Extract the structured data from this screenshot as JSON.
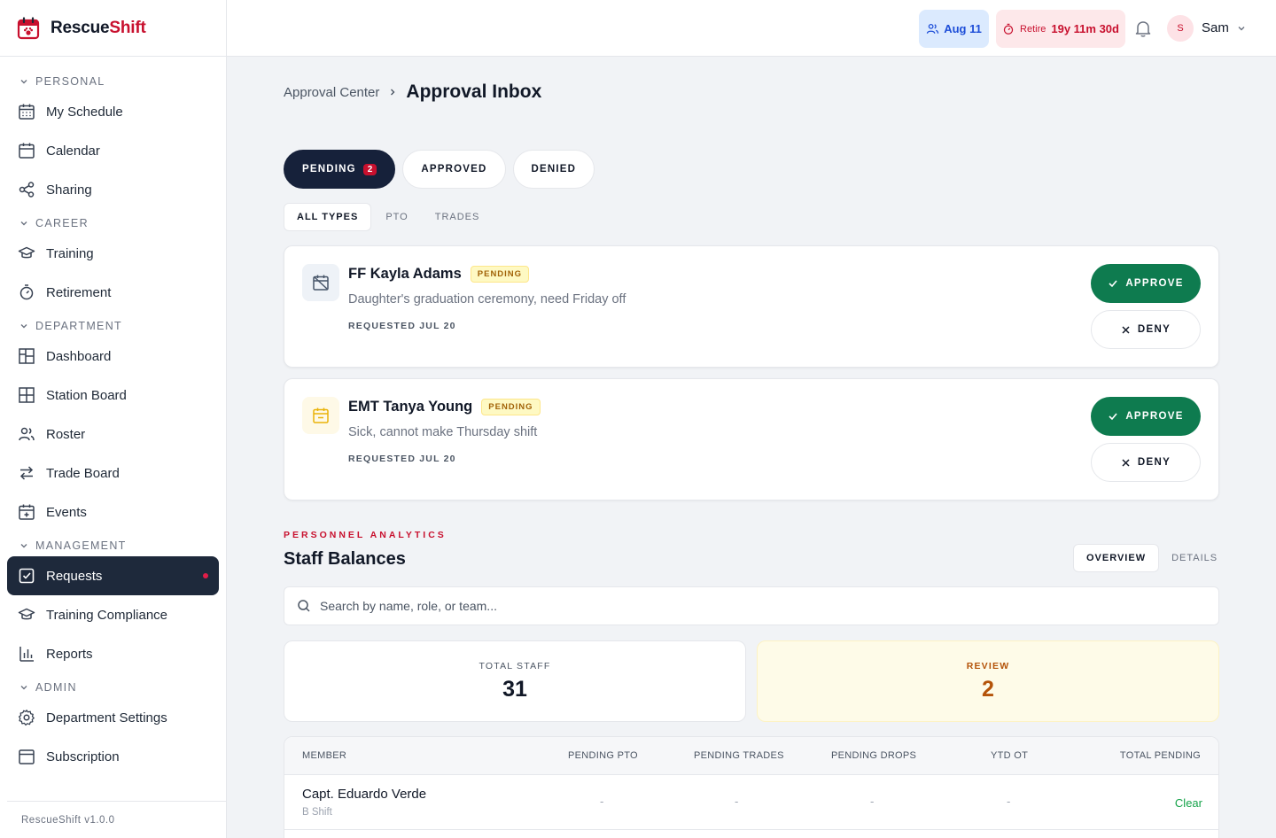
{
  "colors": {
    "brand_red": "#c8102e",
    "navy": "#16213a",
    "approve_green": "#0e7b4f"
  },
  "brand": {
    "name_part1": "Rescue",
    "name_part2": "Shift",
    "icon": "calendar-paw-logo"
  },
  "sidebar": {
    "sections": [
      {
        "title": "PERSONAL",
        "items": [
          {
            "label": "My Schedule",
            "icon": "calendar-grid-icon"
          },
          {
            "label": "Calendar",
            "icon": "calendar-icon"
          },
          {
            "label": "Sharing",
            "icon": "share-icon"
          }
        ]
      },
      {
        "title": "CAREER",
        "items": [
          {
            "label": "Training",
            "icon": "graduation-cap-icon"
          },
          {
            "label": "Retirement",
            "icon": "stopwatch-icon"
          }
        ]
      },
      {
        "title": "DEPARTMENT",
        "items": [
          {
            "label": "Dashboard",
            "icon": "dashboard-icon"
          },
          {
            "label": "Station Board",
            "icon": "board-icon"
          },
          {
            "label": "Roster",
            "icon": "users-icon"
          },
          {
            "label": "Trade Board",
            "icon": "swap-icon"
          },
          {
            "label": "Events",
            "icon": "calendar-plus-icon"
          }
        ]
      },
      {
        "title": "MANAGEMENT",
        "items": [
          {
            "label": "Requests",
            "icon": "check-square-icon",
            "active": true
          },
          {
            "label": "Training Compliance",
            "icon": "graduation-cap-icon"
          },
          {
            "label": "Reports",
            "icon": "bar-chart-icon"
          }
        ]
      },
      {
        "title": "ADMIN",
        "items": [
          {
            "label": "Department Settings",
            "icon": "gear-icon"
          },
          {
            "label": "Subscription",
            "icon": "card-icon"
          }
        ]
      }
    ],
    "footer": "RescueShift v1.0.0"
  },
  "topbar": {
    "date_chip": "Aug 11",
    "retire_label": "Retire",
    "retire_value": "19y 11m 30d",
    "avatar_initial": "S",
    "user_name": "Sam"
  },
  "breadcrumb": {
    "parent": "Approval Center",
    "current": "Approval Inbox"
  },
  "status_tabs": [
    {
      "label": "PENDING",
      "count": "2",
      "active": true
    },
    {
      "label": "APPROVED"
    },
    {
      "label": "DENIED"
    }
  ],
  "type_tabs": [
    {
      "label": "ALL TYPES",
      "active": true
    },
    {
      "label": "PTO"
    },
    {
      "label": "TRADES"
    }
  ],
  "requests": [
    {
      "name": "FF Kayla Adams",
      "status": "PENDING",
      "reason": "Daughter's graduation ceremony, need Friday off",
      "requested": "REQUESTED JUL 20",
      "icon": "calendar-off-icon",
      "approve": "APPROVE",
      "deny": "DENY"
    },
    {
      "name": "EMT Tanya Young",
      "status": "PENDING",
      "reason": "Sick, cannot make Thursday shift",
      "requested": "REQUESTED JUL 20",
      "icon": "calendar-sick-icon",
      "approve": "APPROVE",
      "deny": "DENY"
    }
  ],
  "analytics": {
    "eyebrow": "PERSONNEL ANALYTICS",
    "title": "Staff Balances",
    "view_tabs": [
      {
        "label": "OVERVIEW",
        "active": true
      },
      {
        "label": "DETAILS"
      }
    ],
    "search_placeholder": "Search by name, role, or team...",
    "stats": [
      {
        "label": "TOTAL STAFF",
        "value": "31"
      },
      {
        "label": "REVIEW",
        "value": "2"
      }
    ],
    "table": {
      "columns": [
        "MEMBER",
        "PENDING PTO",
        "PENDING TRADES",
        "PENDING DROPS",
        "YTD OT",
        "TOTAL PENDING"
      ],
      "rows": [
        {
          "member": "Capt. Eduardo Verde",
          "shift": "B Shift",
          "pto": "-",
          "trades": "-",
          "drops": "-",
          "ot": "-",
          "total": "Clear"
        }
      ]
    }
  }
}
